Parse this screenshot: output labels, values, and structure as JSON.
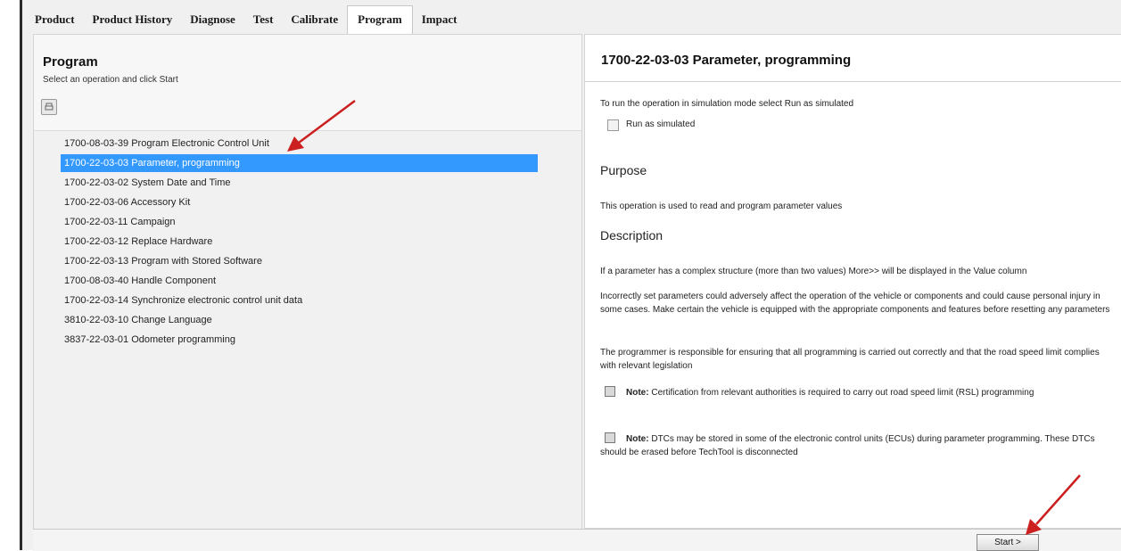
{
  "tabs": [
    {
      "label": "Product"
    },
    {
      "label": "Product History"
    },
    {
      "label": "Diagnose"
    },
    {
      "label": "Test"
    },
    {
      "label": "Calibrate"
    },
    {
      "label": "Program"
    },
    {
      "label": "Impact"
    }
  ],
  "active_tab": "Program",
  "left_panel": {
    "title": "Program",
    "subtitle": "Select an operation and click Start",
    "print_icon": "print-icon",
    "operations": [
      {
        "label": "1700-08-03-39 Program Electronic Control Unit",
        "selected": false
      },
      {
        "label": "1700-22-03-03 Parameter, programming",
        "selected": true
      },
      {
        "label": "1700-22-03-02 System Date and Time",
        "selected": false
      },
      {
        "label": "1700-22-03-06 Accessory Kit",
        "selected": false
      },
      {
        "label": "1700-22-03-11 Campaign",
        "selected": false
      },
      {
        "label": "1700-22-03-12 Replace Hardware",
        "selected": false
      },
      {
        "label": "1700-22-03-13 Program with Stored Software",
        "selected": false
      },
      {
        "label": "1700-08-03-40 Handle Component",
        "selected": false
      },
      {
        "label": "1700-22-03-14 Synchronize electronic control unit data",
        "selected": false
      },
      {
        "label": "3810-22-03-10 Change Language",
        "selected": false
      },
      {
        "label": "3837-22-03-01 Odometer programming",
        "selected": false
      }
    ]
  },
  "right_panel": {
    "title": "1700-22-03-03 Parameter, programming",
    "sim_text": "To run the operation in simulation mode select Run as simulated",
    "sim_checkbox_label": "Run as simulated",
    "purpose_heading": "Purpose",
    "purpose_text": "This operation is used to read and program parameter values",
    "description_heading": "Description",
    "desc_p1": "If a parameter has a complex structure (more than two values) More>> will be displayed in the Value column",
    "desc_p2": "Incorrectly set parameters could adversely affect the operation of the vehicle or components and could cause personal injury in some cases. Make certain the vehicle is equipped with the appropriate components and features before resetting any parameters",
    "desc_p3": "The programmer is responsible for ensuring that all programming is carried out correctly and that the road speed limit complies with relevant legislation",
    "note_label": "Note:",
    "note1_text": " Certification from relevant authorities is required to carry out road speed limit (RSL) programming",
    "note2_text": " DTCs may be stored in some of the electronic control units (ECUs) during parameter programming. These DTCs should be erased before TechTool is disconnected"
  },
  "start_button": "Start >",
  "colors": {
    "selection": "#3399ff",
    "arrow": "#cc1f1f"
  }
}
